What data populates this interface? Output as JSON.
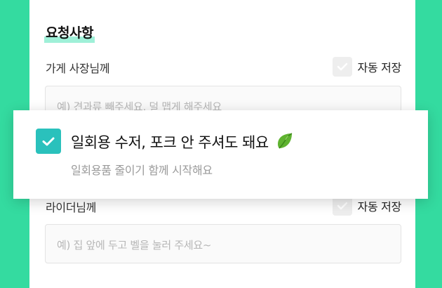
{
  "colors": {
    "background": "#34dba0",
    "accent": "#2ac1bc"
  },
  "section": {
    "title": "요청사항"
  },
  "store_request": {
    "label": "가게 사장님께",
    "autosave_label": "자동 저장",
    "autosave_checked": false,
    "placeholder": "예) 견과류 빼주세요, 덜 맵게 해주세요"
  },
  "utensils_popup": {
    "checked": true,
    "title": "일회용 수저, 포크 안 주셔도 돼요",
    "icon": "leaf-icon",
    "subtitle": "일회용품 줄이기 함께 시작해요"
  },
  "rider_request": {
    "label": "라이더님께",
    "autosave_label": "자동 저장",
    "autosave_checked": false,
    "placeholder": "예) 집 앞에 두고 벨을 눌러 주세요~"
  }
}
